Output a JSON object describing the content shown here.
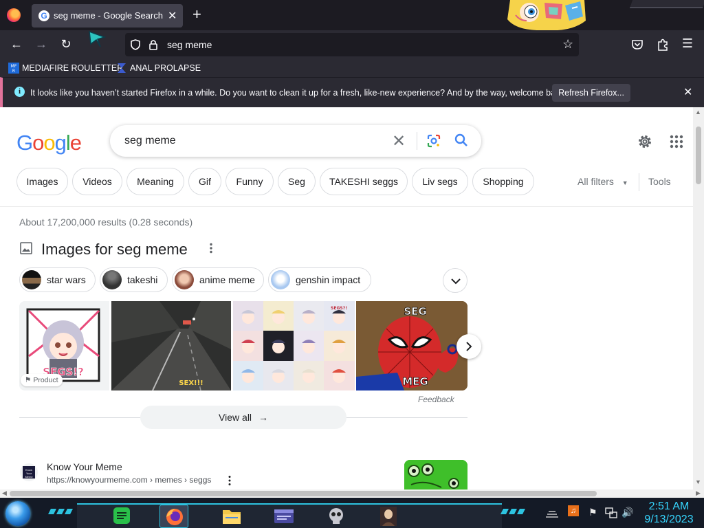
{
  "browser": {
    "tab_title": "seg meme - Google Search",
    "tab_favicon": "G",
    "url": "seg meme",
    "new_tab": "+",
    "close_tab": "✕"
  },
  "bookmarks": [
    {
      "label": "MEDIAFIRE ROULETTER",
      "icon": "mediafire-icon"
    },
    {
      "label": "ANAL PROLAPSE",
      "icon": "sigma-icon"
    }
  ],
  "notification": {
    "message": "It looks like you haven’t started Firefox in a while. Do you want to clean it up for a fresh, like-new experience? And by the way, welcome back!",
    "button": "Refresh Firefox...",
    "accent": "#e2739b"
  },
  "search": {
    "query": "seg meme",
    "logo": [
      "G",
      "o",
      "o",
      "g",
      "l",
      "e"
    ],
    "logo_colors": [
      "#4285f4",
      "#ea4335",
      "#fbbc05",
      "#4285f4",
      "#34a853",
      "#ea4335"
    ]
  },
  "filter_chips": [
    "Images",
    "Videos",
    "Meaning",
    "Gif",
    "Funny",
    "Seg",
    "TAKESHI seggs",
    "Liv segs",
    "Shopping"
  ],
  "all_filters": "All filters",
  "tools": "Tools",
  "result_stats": "About 17,200,000 results (0.28 seconds)",
  "images_section": {
    "heading": "Images for seg meme",
    "sub_chips": [
      "star wars",
      "takeshi",
      "anime meme",
      "genshin impact"
    ],
    "product_badge": "Product",
    "thumb_captions": [
      "SEGS!?",
      "SEX!!!",
      "SEGS?!",
      "SEG",
      "MEG"
    ],
    "feedback": "Feedback",
    "view_all": "View all"
  },
  "result": {
    "site_name": "Know Your Meme",
    "cite": "https://knowyourmeme.com › memes › seggs",
    "favicon_text": "Know Your Meme"
  },
  "taskbar": {
    "time": "2:51 AM",
    "date": "9/13/2023",
    "accent": "#2dc3e0"
  }
}
